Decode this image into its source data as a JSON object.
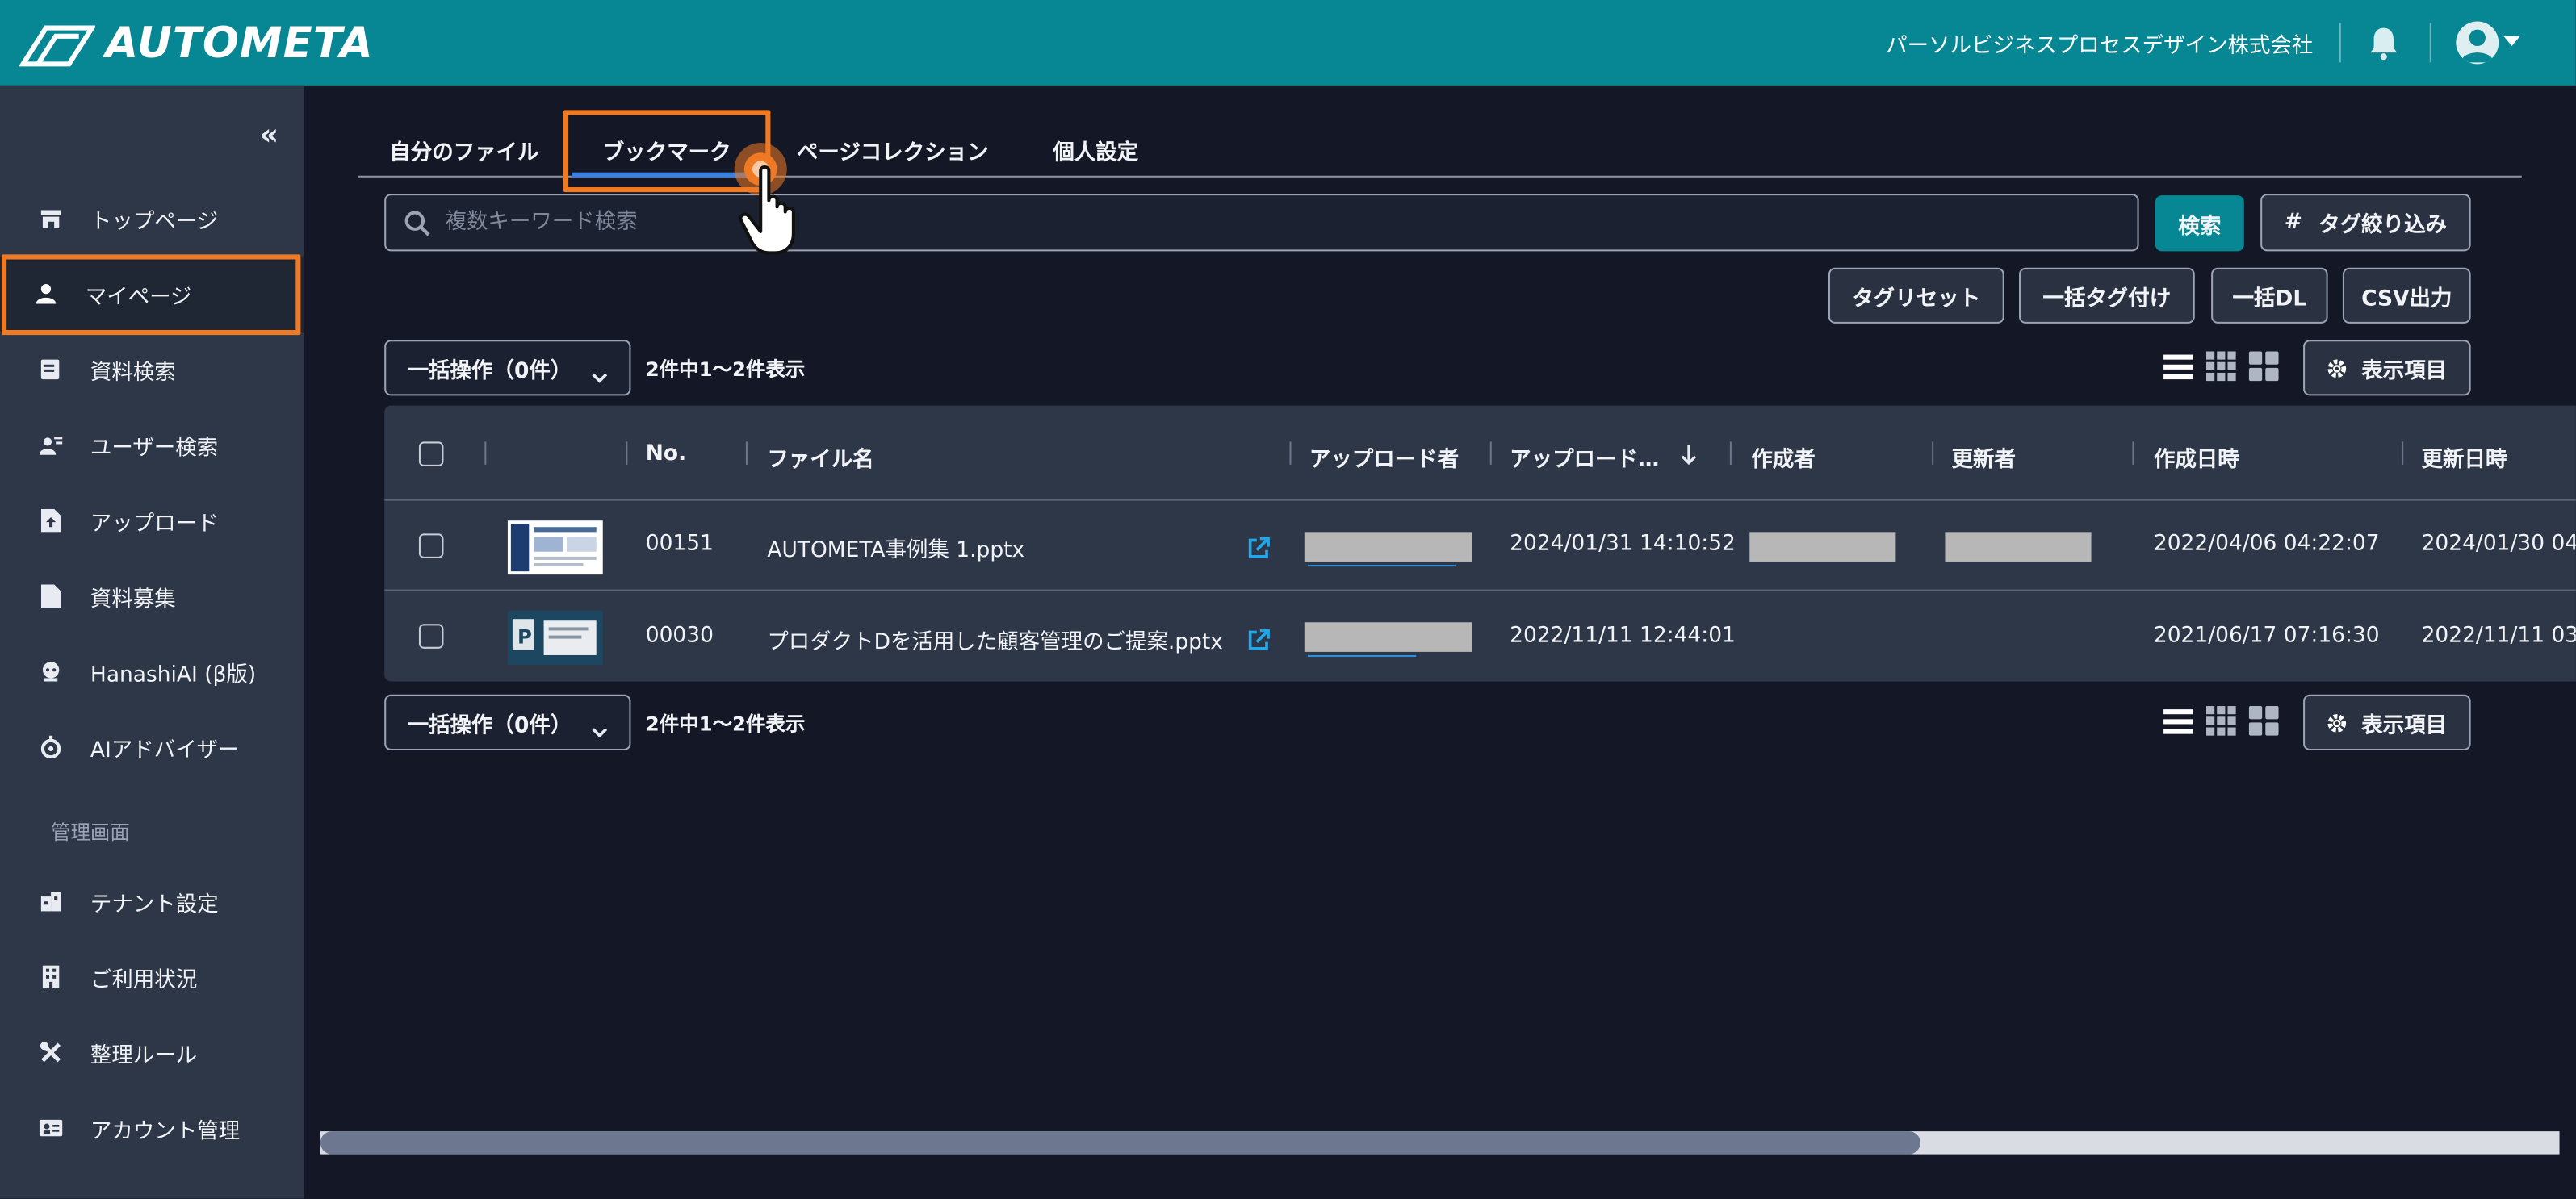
{
  "header": {
    "logo_text": "AUTOMETA",
    "company": "パーソルビジネスプロセスデザイン株式会社",
    "bell_icon": "bell-icon",
    "avatar_icon": "user-avatar-icon"
  },
  "sidebar": {
    "collapse_label": "«",
    "section_admin": "管理画面",
    "items": [
      {
        "label": "トップページ",
        "icon": "store-icon"
      },
      {
        "label": "マイページ",
        "icon": "user-icon"
      },
      {
        "label": "資料検索",
        "icon": "document-search-icon"
      },
      {
        "label": "ユーザー検索",
        "icon": "user-search-icon"
      },
      {
        "label": "アップロード",
        "icon": "file-upload-icon"
      },
      {
        "label": "資料募集",
        "icon": "file-icon"
      },
      {
        "label": "HanashiAI (β版)",
        "icon": "chat-bot-icon"
      },
      {
        "label": "AIアドバイザー",
        "icon": "robot-icon"
      },
      {
        "label": "テナント設定",
        "icon": "building-settings-icon"
      },
      {
        "label": "ご利用状況",
        "icon": "building-icon"
      },
      {
        "label": "整理ルール",
        "icon": "tools-icon"
      },
      {
        "label": "アカウント管理",
        "icon": "id-card-icon"
      }
    ]
  },
  "tabs": [
    {
      "label": "自分のファイル"
    },
    {
      "label": "ブックマーク"
    },
    {
      "label": "ページコレクション"
    },
    {
      "label": "個人設定"
    }
  ],
  "search": {
    "placeholder": "複数キーワード検索",
    "button": "検索",
    "tag_filter": "タグ絞り込み",
    "tag_filter_icon": "#"
  },
  "toolbar": {
    "tag_reset": "タグリセット",
    "bulk_tag": "一括タグ付け",
    "bulk_dl": "一括DL",
    "csv_export": "CSV出力",
    "display_items": "表示項目"
  },
  "bulk_ops": {
    "label": "一括操作（0件）",
    "count_text": "2件中1〜2件表示"
  },
  "table": {
    "columns": [
      "No.",
      "ファイル名",
      "アップロード者",
      "アップロード…",
      "作成者",
      "更新者",
      "作成日時",
      "更新日時"
    ],
    "rows": [
      {
        "no": "00151",
        "file_name": "AUTOMETA事例集 1.pptx",
        "uploaded_at": "2024/01/31 14:10:52",
        "created_at": "2022/04/06 04:22:07",
        "updated_at": "2024/01/30 04"
      },
      {
        "no": "00030",
        "file_name": "プロダクトDを活用した顧客管理のご提案.pptx",
        "uploaded_at": "2022/11/11 12:44:01",
        "created_at": "2021/06/17 07:16:30",
        "updated_at": "2022/11/11 03"
      }
    ]
  },
  "colors": {
    "header": "#078793",
    "sidebar": "#2d3748",
    "background": "#141826",
    "highlight": "#f07a24",
    "tab_underline": "#3b7fe0"
  }
}
